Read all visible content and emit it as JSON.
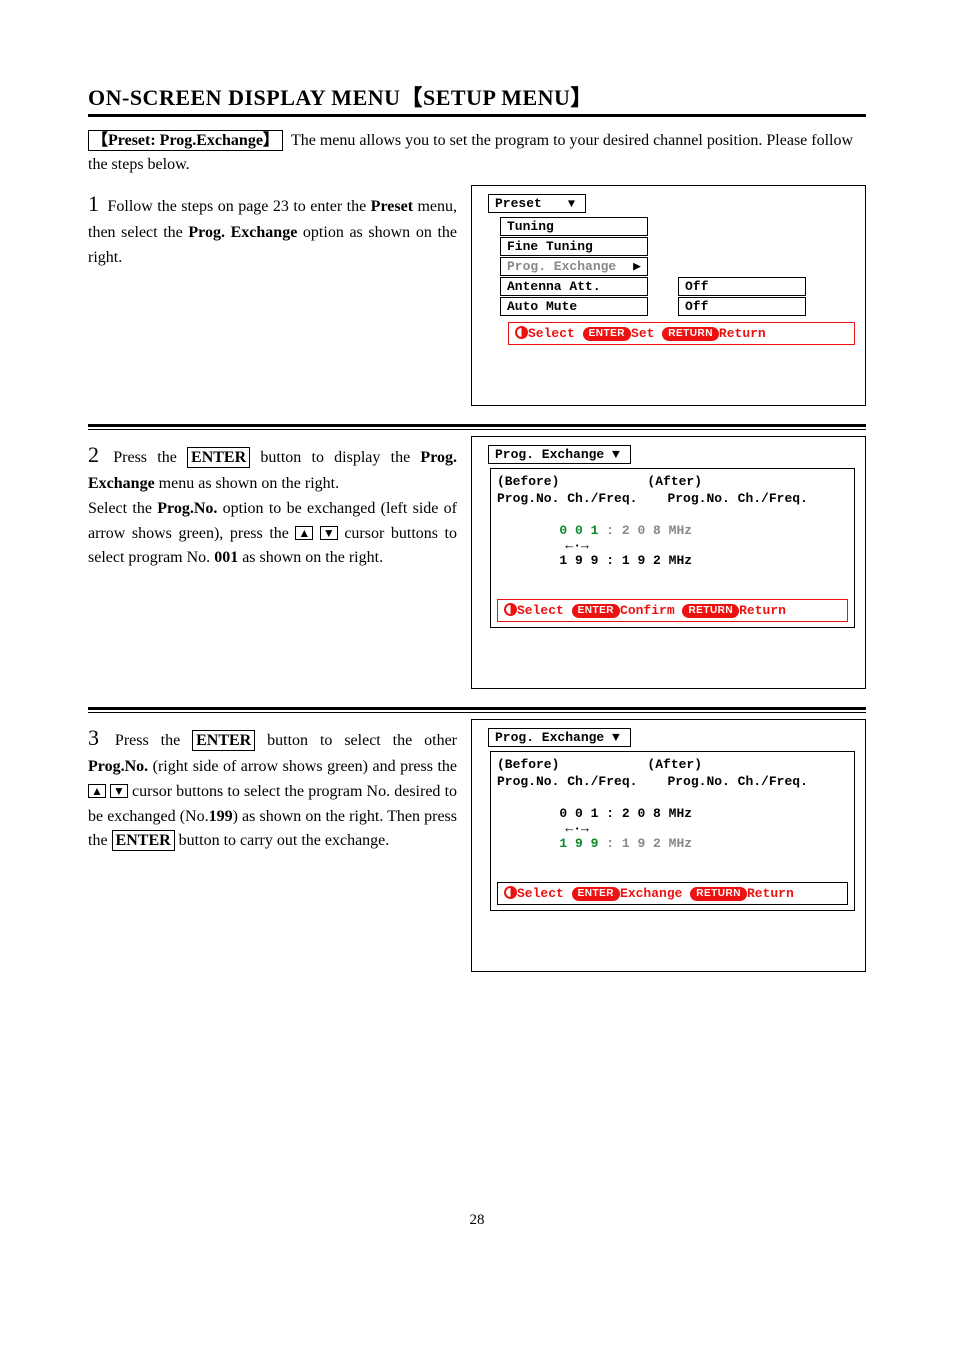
{
  "page": {
    "title": "ON-SCREEN DISPLAY MENU【SETUP MENU】",
    "section_bracket": "【Preset: Prog.Exchange】",
    "section_desc": "The menu allows you to set the program to your desired channel position. Please follow the steps below.",
    "page_number": "28"
  },
  "step1": {
    "num": "1",
    "text_a": "Follow the steps on page 23 to enter the ",
    "preset": "Preset",
    "text_b": " menu, then select the ",
    "progex": "Prog. Exchange",
    "text_c": " option as shown on the right.",
    "osd": {
      "title": "Preset",
      "items": [
        {
          "label": "Tuning",
          "value": "",
          "hasVal": false,
          "gray": false
        },
        {
          "label": "Fine Tuning",
          "value": "",
          "hasVal": false,
          "gray": false
        },
        {
          "label": "Prog. Exchange",
          "value": "▶",
          "hasVal": false,
          "gray": true,
          "arrowRight": true
        },
        {
          "label": "Antenna Att.",
          "value": "Off",
          "hasVal": true,
          "gray": false
        },
        {
          "label": "Auto Mute",
          "value": "Off",
          "hasVal": true,
          "gray": false
        }
      ],
      "footer": {
        "select": "Select",
        "enter": "ENTER",
        "mid": "Set",
        "return": "RETURN",
        "end": "Return"
      }
    }
  },
  "step2": {
    "num": "2",
    "text_a": "Press the ",
    "enter": "ENTER",
    "text_b": " button to display the ",
    "progex": "Prog. Exchange",
    "text_c": " menu as shown on the right.",
    "text_d": "Select the ",
    "progno": "Prog.No.",
    "text_e": " option to be exchanged (left side of arrow shows green), press the ",
    "text_f": " cursor buttons to select program No. ",
    "p001": "001",
    "text_g": " as shown on the right.",
    "osd": {
      "title": "Prog. Exchange",
      "before": "(Before)",
      "after": "(After)",
      "colL": "Prog.No. Ch./Freq.",
      "colR": "Prog.No. Ch./Freq.",
      "left_prog": "0 0 1",
      "left_freq": "2 0 8 MHz",
      "arrows": "←·→",
      "right_prog": "1 9 9",
      "right_freq": "1 9 2 MHz",
      "footer": {
        "select": "Select",
        "enter": "ENTER",
        "mid": "Confirm",
        "return": "RETURN",
        "end": "Return"
      }
    }
  },
  "step3": {
    "num": "3",
    "text_a": "Press the ",
    "enter": "ENTER",
    "text_b": " button to select the other ",
    "progno": "Prog.No.",
    "text_c": " (right side of arrow shows green) and press the ",
    "text_d": " cursor buttons to select the program No. desired to be exchanged (No.",
    "n199": "199",
    "text_e": ") as shown on the right. Then press the ",
    "enter2": "ENTER",
    "text_f": " button to carry out the exchange.",
    "osd": {
      "title": "Prog. Exchange",
      "before": "(Before)",
      "after": "(After)",
      "colL": "Prog.No. Ch./Freq.",
      "colR": "Prog.No. Ch./Freq.",
      "left_prog": "0 0 1",
      "left_freq": "2 0 8 MHz",
      "arrows": "←·→",
      "right_prog": "1 9 9",
      "right_freq": "1 9 2 MHz",
      "footer": {
        "select": "Select",
        "enter": "ENTER",
        "mid": "Exchange",
        "return": "RETURN",
        "end": "Return"
      }
    }
  }
}
